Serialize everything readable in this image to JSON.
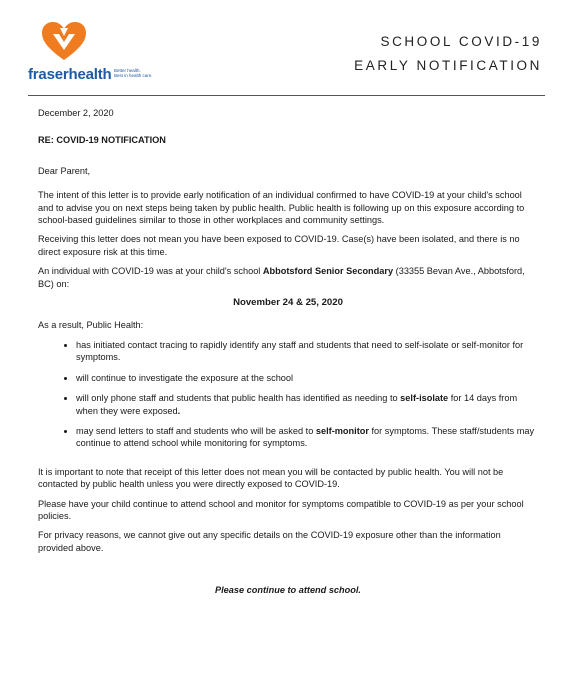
{
  "header": {
    "brand_part1": "fraser",
    "brand_part2": "health",
    "tagline_line1": "Better health.",
    "tagline_line2": "Best in health care.",
    "title_line1": "SCHOOL COVID-19",
    "title_line2": "EARLY NOTIFICATION",
    "logo_colors": {
      "orange": "#f07c22",
      "blue": "#1f5aa6"
    }
  },
  "letter": {
    "date": "December 2, 2020",
    "re": "RE: COVID-19 NOTIFICATION",
    "greeting": "Dear Parent,",
    "para1": "The intent of this letter is to provide early notification of an individual confirmed to have COVID-19 at your child's school and to advise you on next steps being taken by public health. Public health is following up on this exposure according to school-based guidelines similar to those in other workplaces and community settings.",
    "para2": "Receiving this letter does not mean you have been exposed to COVID-19. Case(s) have been isolated, and there is no direct exposure risk at this time.",
    "para3_pre": "An individual with COVID-19 was at your child's school ",
    "school_name": "Abbotsford Senior Secondary",
    "para3_post": " (33355 Bevan Ave., Abbotsford, BC) on:",
    "exposure_dates": "November 24 & 25, 2020",
    "result_intro": "As a result, Public Health:",
    "bullet1": "has initiated contact tracing to rapidly identify any staff and students that need to self-isolate or self-monitor for symptoms.",
    "bullet2": "will continue to investigate the exposure at the school",
    "bullet3_pre": "will only phone staff and students that public health has identified as needing to ",
    "bullet3_bold": "self-isolate",
    "bullet3_post": " for 14 days from when they were exposed",
    "bullet3_end": ".",
    "bullet4_pre": "may send letters to staff and students who will be asked to ",
    "bullet4_bold": "self-monitor",
    "bullet4_post": " for symptoms. These staff/students may continue to attend school while monitoring for symptoms.",
    "para4": "It is important to note that receipt of this letter does not mean you will be contacted by public health. You will not be contacted by public health unless you were directly exposed to COVID-19.",
    "para5": "Please have your child continue to attend school and monitor for symptoms compatible to COVID-19 as per your school policies.",
    "para6": "For privacy reasons, we cannot give out any specific details on the COVID-19 exposure other than the information  provided above.",
    "closing": "Please continue to attend school."
  }
}
